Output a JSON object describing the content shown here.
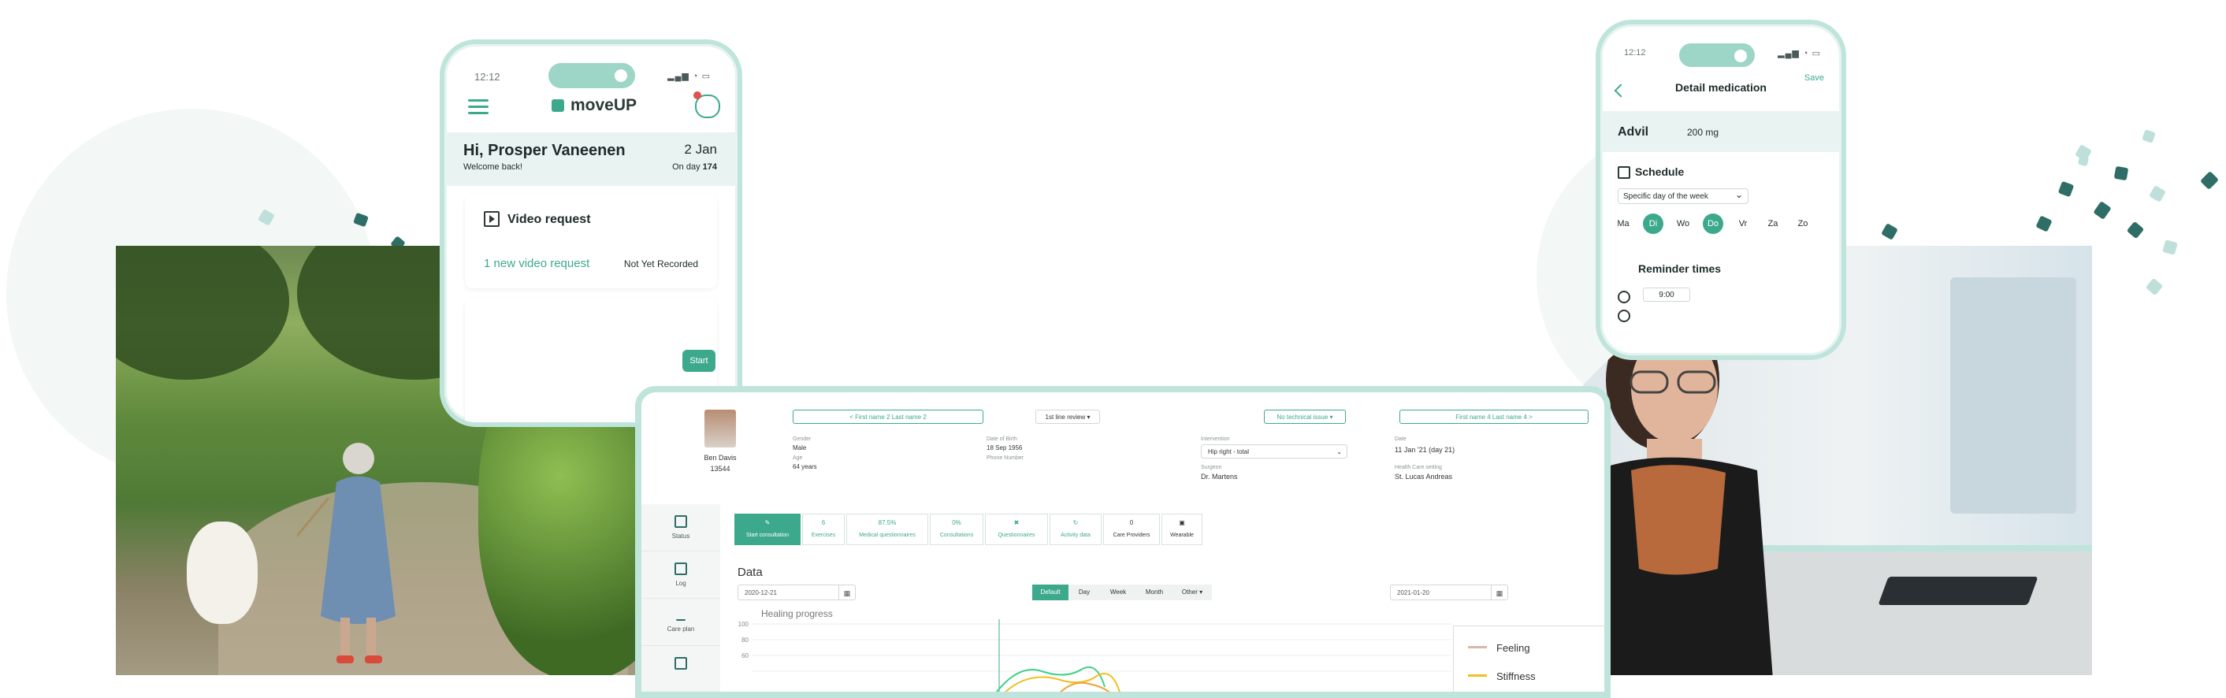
{
  "colors": {
    "accent": "#3da98c",
    "frame": "#bfe4db",
    "dark_teal": "#2f6e66"
  },
  "phone_home": {
    "time": "12:12",
    "app_name": "moveUP",
    "greeting": "Hi, Prosper Vaneenen",
    "welcome": "Welcome back!",
    "date": "2 Jan",
    "on_day_prefix": "On day ",
    "on_day_value": "174",
    "card_title": "Video request",
    "card_link": "1 new video request",
    "card_status": "Not Yet Recorded",
    "start_label": "Start",
    "icons": [
      "menu-icon",
      "chat-icon",
      "play-icon"
    ]
  },
  "phone_medication": {
    "time": "12:12",
    "title": "Detail medication",
    "save_label": "Save",
    "med_name": "Advil",
    "dose": "200 mg",
    "schedule_label": "Schedule",
    "schedule_option": "Specific day of the week",
    "days": [
      {
        "label": "Ma",
        "on": false
      },
      {
        "label": "Di",
        "on": true
      },
      {
        "label": "Wo",
        "on": false
      },
      {
        "label": "Do",
        "on": true
      },
      {
        "label": "Vr",
        "on": false
      },
      {
        "label": "Za",
        "on": false
      },
      {
        "label": "Zo",
        "on": false
      }
    ],
    "reminder_label": "Reminder times",
    "reminder_time": "9:00"
  },
  "dashboard": {
    "patient_name": "Ben Davis",
    "patient_id": "13544",
    "nav_prev": "< First name 2 Last name 2",
    "review": "1st line review",
    "issue": "No technical issue",
    "nav_next": "First name 4 Last name 4 >",
    "gender_label": "Gender",
    "gender": "Male",
    "age_label": "Age",
    "age": "64 years",
    "dob_label": "Date of Birth",
    "dob": "18 Sep 1956",
    "phone_label": "Phone Number",
    "intervention_label": "Intervention",
    "intervention": "Hip right - total",
    "surgeon_label": "Surgeon",
    "surgeon": "Dr. Martens",
    "date_label": "Date",
    "date": "11 Jan '21 (day 21)",
    "care_label": "Health Care setting",
    "care": "St. Lucas Andreas",
    "sidebar": [
      "Status",
      "Log",
      "Care plan"
    ],
    "tiles": [
      {
        "value": "",
        "label": "Start consultation"
      },
      {
        "value": "6",
        "label": "Exercises"
      },
      {
        "value": "87.5%",
        "label": "Medical questionnaires"
      },
      {
        "value": "0%",
        "label": "Consultations"
      },
      {
        "value": "",
        "label": "Questionnaires"
      },
      {
        "value": "",
        "label": "Activity data"
      },
      {
        "value": "0",
        "label": "Care Providers"
      },
      {
        "value": "",
        "label": "Wearable"
      }
    ],
    "data_heading": "Data",
    "date_from": "2020-12-21",
    "date_to": "2021-01-20",
    "periods": [
      "Default",
      "Day",
      "Week",
      "Month",
      "Other"
    ],
    "chart_title": "Healing progress",
    "y_ticks": [
      "100",
      "80",
      "60"
    ],
    "legend": [
      "Feeling",
      "Stiffness"
    ]
  }
}
